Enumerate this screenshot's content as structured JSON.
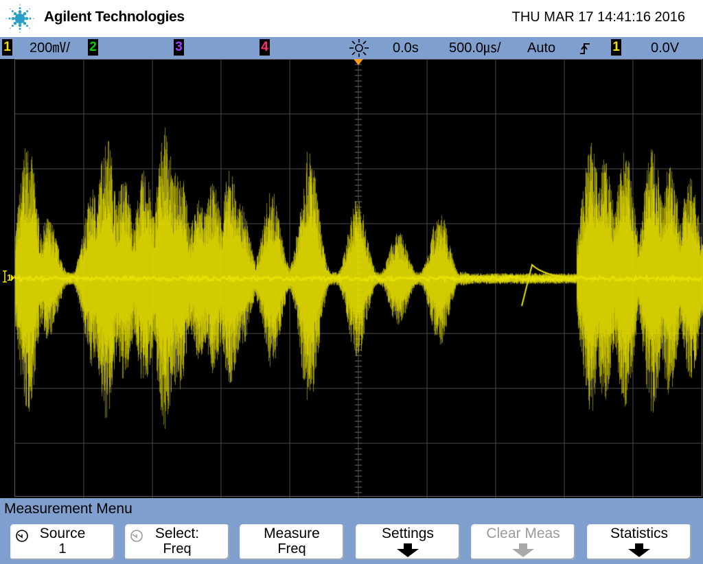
{
  "header": {
    "brand": "Agilent Technologies",
    "datetime": "THU MAR 17 14:41:16 2016"
  },
  "status": {
    "ch1_label": "1",
    "ch1_scale": "200㎷/",
    "ch2_label": "2",
    "ch3_label": "3",
    "ch4_label": "4",
    "time_delay": "0.0s",
    "time_scale": "500.0㎲/",
    "trigger_mode": "Auto",
    "trigger_slope": "rising-edge-icon",
    "trigger_source": "1",
    "trigger_level": "0.0V"
  },
  "screen": {
    "ground_marker": "1",
    "trace_color": "#e8e000"
  },
  "menu": {
    "title": "Measurement Menu",
    "softkeys": [
      {
        "line1": "Source",
        "line2": "1"
      },
      {
        "line1": "Select:",
        "line2": "Freq"
      },
      {
        "line1": "Measure",
        "line2": "Freq"
      },
      {
        "line1": "Settings",
        "line2": ""
      },
      {
        "line1": "Clear Meas",
        "line2": ""
      },
      {
        "line1": "Statistics",
        "line2": ""
      }
    ]
  },
  "colors": {
    "ch1": "#f0e000",
    "ch2": "#00d000",
    "ch3": "#a040ff",
    "ch4": "#ff3070",
    "bar": "#7f9fcf",
    "trigger_marker": "#ff9a1a"
  }
}
